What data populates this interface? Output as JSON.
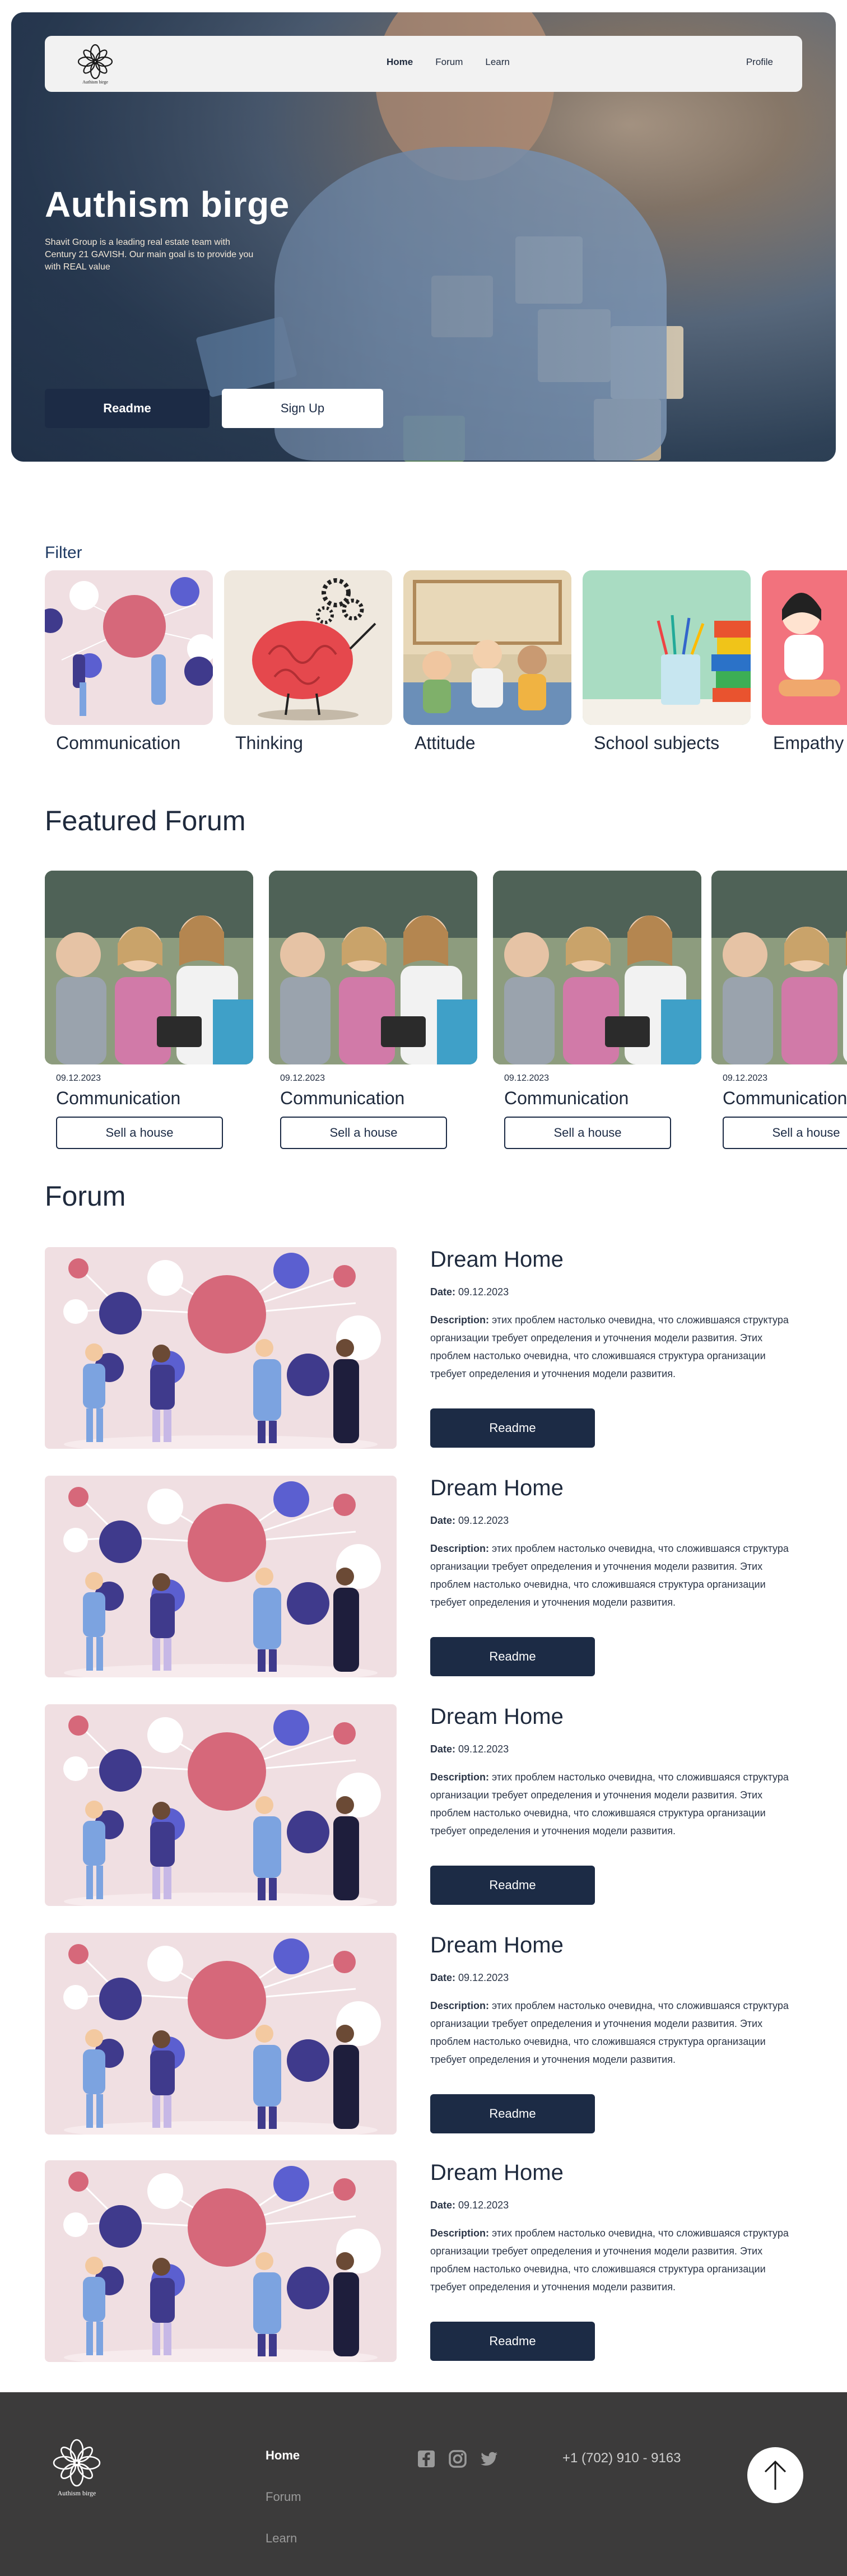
{
  "nav": {
    "brand": "Authism birge",
    "links": [
      "Home",
      "Forum",
      "Learn"
    ],
    "profile": "Profile"
  },
  "hero": {
    "title": "Authism birge",
    "subtitle": "Shavit Group is a leading real estate team with Century 21 GAVISH. Our main goal is to provide you with REAL value",
    "primary_button": "Readme",
    "secondary_button": "Sign Up"
  },
  "filter": {
    "title": "Filter",
    "categories": [
      "Communication",
      "Thinking",
      "Attitude",
      "School subjects",
      "Empathy"
    ]
  },
  "featured": {
    "title": "Featured Forum",
    "cards": [
      {
        "date": "09.12.2023",
        "title": "Communication",
        "button": "Sell a house"
      },
      {
        "date": "09.12.2023",
        "title": "Communication",
        "button": "Sell a house"
      },
      {
        "date": "09.12.2023",
        "title": "Communication",
        "button": "Sell a house"
      },
      {
        "date": "09.12.2023",
        "title": "Communication",
        "button": "Sell a house"
      }
    ]
  },
  "forum": {
    "title": "Forum",
    "date_label": "Date:",
    "desc_label": "Description:",
    "posts": [
      {
        "title": "Dream Home",
        "date": "09.12.2023",
        "description": "этих проблем настолько очевидна, что сложившаяся структура организации требует определения и уточнения модели развития. Этих проблем настолько очевидна, что сложившаяся структура организации требует определения и уточнения модели развития.",
        "button": "Readme"
      },
      {
        "title": "Dream Home",
        "date": "09.12.2023",
        "description": "этих проблем настолько очевидна, что сложившаяся структура организации требует определения и уточнения модели развития. Этих проблем настолько очевидна, что сложившаяся структура организации требует определения и уточнения модели развития.",
        "button": "Readme"
      },
      {
        "title": "Dream Home",
        "date": "09.12.2023",
        "description": "этих проблем настолько очевидна, что сложившаяся структура организации требует определения и уточнения модели развития. Этих проблем настолько очевидна, что сложившаяся структура организации требует определения и уточнения модели развития.",
        "button": "Readme"
      },
      {
        "title": "Dream Home",
        "date": "09.12.2023",
        "description": "этих проблем настолько очевидна, что сложившаяся структура организации требует определения и уточнения модели развития. Этих проблем настолько очевидна, что сложившаяся структура организации требует определения и уточнения модели развития.",
        "button": "Readme"
      },
      {
        "title": "Dream Home",
        "date": "09.12.2023",
        "description": "этих проблем настолько очевидна, что сложившаяся структура организации требует определения и уточнения модели развития. Этих проблем настолько очевидна, что сложившаяся структура организации требует определения и уточнения модели развития.",
        "button": "Readme"
      }
    ]
  },
  "footer": {
    "brand": "Authism birge",
    "links": [
      "Home",
      "Forum",
      "Learn"
    ],
    "social_icons": [
      "facebook-icon",
      "instagram-icon",
      "twitter-icon"
    ],
    "phone": "+1 (702) 910 - 9163",
    "scroll_top_icon": "arrow-up-icon"
  },
  "colors": {
    "primary": "#1c2b45",
    "footer_bg": "#3c3b3b",
    "illustration_bg": "#f0dfe2",
    "circle_pink": "#d6687a",
    "circle_indigo": "#3f3a8c",
    "circle_blue": "#5b5fd0"
  }
}
